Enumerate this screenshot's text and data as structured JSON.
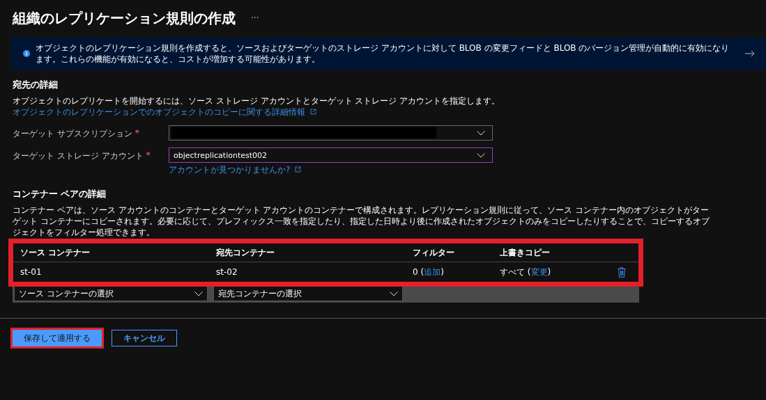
{
  "page": {
    "title": "組織のレプリケーション規則の作成",
    "more": "···"
  },
  "info_banner": {
    "text": "オブジェクトのレプリケーション規則を作成すると、ソースおよびターゲットのストレージ アカウントに対して BLOB の変更フィードと BLOB のバージョン管理が自動的に有効になります。これらの機能が有効になると、コストが増加する可能性があります。"
  },
  "destination": {
    "heading": "宛先の詳細",
    "description": "オブジェクトのレプリケートを開始するには、ソース ストレージ アカウントとターゲット ストレージ アカウントを指定します。",
    "link": "オブジェクトのレプリケーションでのオブジェクトのコピーに関する詳細情報"
  },
  "fields": [
    {
      "label": "ターゲット サブスクリプション",
      "required_mark": "*",
      "redacted": true,
      "focused": false
    },
    {
      "label": "ターゲット ストレージ アカウント",
      "required_mark": "*",
      "value": "objectreplicationtest002",
      "focused": true,
      "help_link": "アカウントが見つかりませんか?"
    }
  ],
  "container_pairs": {
    "heading": "コンテナー ペアの詳細",
    "description": "コンテナー ペアは、ソース アカウントのコンテナーとターゲット アカウントのコンテナーで構成されます。レプリケーション規則に従って、ソース コンテナー内のオブジェクトがターゲット コンテナーにコピーされます。必要に応じて、プレフィックス一致を指定したり、指定した日時より後に作成されたオブジェクトのみをコピーしたりすることで、コピーするオブジェクトをフィルター処理できます。",
    "highlighted": true,
    "columns": [
      "ソース コンテナー",
      "宛先コンテナー",
      "フィルター",
      "上書きコピー"
    ],
    "rows": [
      {
        "source": "st-01",
        "destination": "st-02",
        "filter": {
          "before": "0 (",
          "link": "追加",
          "after": ")"
        },
        "overwrite": {
          "before": "すべて (",
          "link": "変更",
          "after": ")"
        }
      }
    ],
    "source_select": {
      "placeholder": "ソース コンテナーの選択"
    },
    "destination_select": {
      "placeholder": "宛先コンテナーの選択"
    }
  },
  "buttons": [
    {
      "label": "保存して適用する",
      "kind": "primary",
      "highlighted": true
    },
    {
      "label": "キャンセル",
      "kind": "secondary",
      "highlighted": false
    }
  ]
}
